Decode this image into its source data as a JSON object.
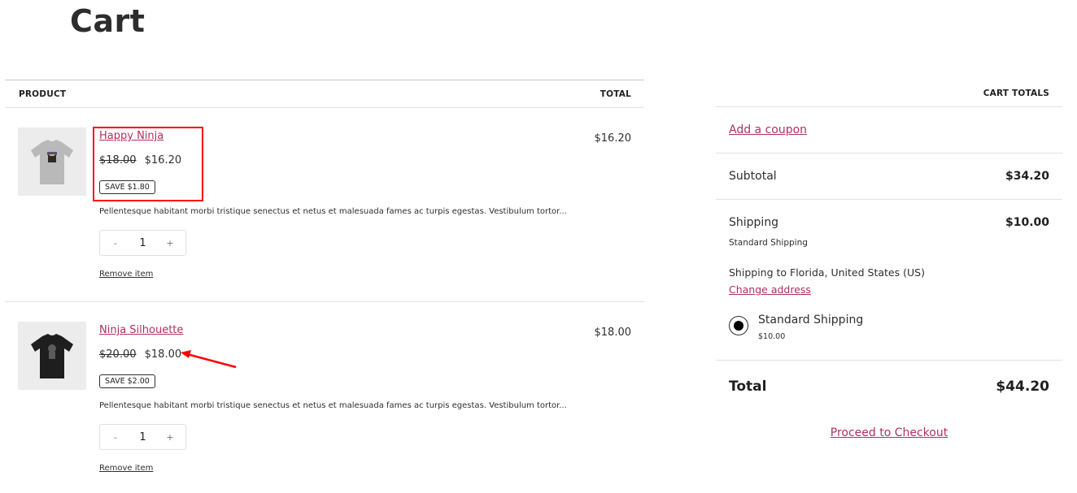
{
  "page": {
    "title": "Cart"
  },
  "colors": {
    "link": "#b03060",
    "annotation": "#ff0000"
  },
  "cart": {
    "headers": {
      "product": "PRODUCT",
      "total": "TOTAL"
    },
    "items": [
      {
        "name": "Happy Ninja",
        "image": "grey-tshirt-ninja",
        "regular_price": "$18.00",
        "sale_price": "$16.20",
        "save_badge": "SAVE $1.80",
        "description": "Pellentesque habitant morbi tristique senectus et netus et malesuada fames ac turpis egestas. Vestibulum tortor...",
        "quantity": "1",
        "qty_minus": "-",
        "qty_plus": "+",
        "remove_label": "Remove item",
        "line_total": "$16.20"
      },
      {
        "name": "Ninja Silhouette",
        "image": "black-tshirt-silhouette",
        "regular_price": "$20.00",
        "sale_price": "$18.00",
        "save_badge": "SAVE $2.00",
        "description": "Pellentesque habitant morbi tristique senectus et netus et malesuada fames ac turpis egestas. Vestibulum tortor...",
        "quantity": "1",
        "qty_minus": "-",
        "qty_plus": "+",
        "remove_label": "Remove item",
        "line_total": "$18.00"
      }
    ]
  },
  "totals": {
    "heading": "CART TOTALS",
    "coupon_link": "Add a coupon",
    "subtotal_label": "Subtotal",
    "subtotal_value": "$34.20",
    "shipping_label": "Shipping",
    "shipping_value": "$10.00",
    "shipping_method": "Standard Shipping",
    "shipping_to": "Shipping to Florida, United States (US)",
    "change_address": "Change address",
    "shipping_option": {
      "label": "Standard Shipping",
      "price": "$10.00",
      "selected": true
    },
    "total_label": "Total",
    "total_value": "$44.20",
    "checkout_label": "Proceed to Checkout"
  },
  "annotations": {
    "highlight_box": "around first item name, prices and save badge",
    "arrow": "pointing at second item sale price"
  }
}
